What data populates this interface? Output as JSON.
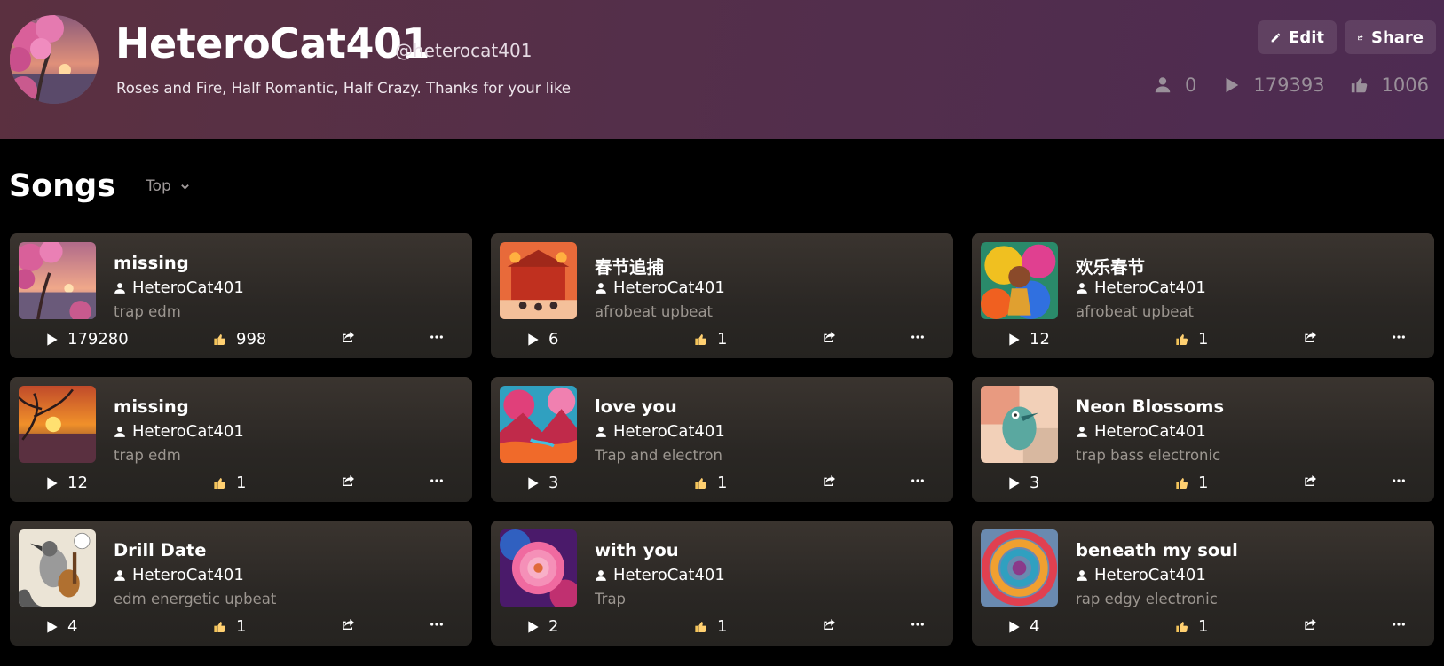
{
  "profile": {
    "name": "HeteroCat401",
    "handle": "@heterocat401",
    "bio": "Roses and Fire, Half Romantic, Half Crazy. Thanks for your like",
    "edit_label": "Edit",
    "share_label": "Share",
    "followers": "0",
    "plays": "179393",
    "likes": "1006"
  },
  "songs_section": {
    "title": "Songs",
    "sort_label": "Top"
  },
  "songs": [
    {
      "title": "missing",
      "artist": "HeteroCat401",
      "genre": "trap edm",
      "plays": "179280",
      "likes": "998",
      "cover": "pink-tree-sunset"
    },
    {
      "title": "春节追捕",
      "artist": "HeteroCat401",
      "genre": "afrobeat upbeat",
      "plays": "6",
      "likes": "1",
      "cover": "red-festival"
    },
    {
      "title": "欢乐春节",
      "artist": "HeteroCat401",
      "genre": "afrobeat upbeat",
      "plays": "12",
      "likes": "1",
      "cover": "colorful-dancer"
    },
    {
      "title": "missing",
      "artist": "HeteroCat401",
      "genre": "trap edm",
      "plays": "12",
      "likes": "1",
      "cover": "sunset-tree"
    },
    {
      "title": "love you",
      "artist": "HeteroCat401",
      "genre": "Trap and electron",
      "plays": "3",
      "likes": "1",
      "cover": "fantasy-landscape"
    },
    {
      "title": "Neon Blossoms",
      "artist": "HeteroCat401",
      "genre": "trap bass electronic",
      "plays": "3",
      "likes": "1",
      "cover": "teal-bird"
    },
    {
      "title": "Drill Date",
      "artist": "HeteroCat401",
      "genre": "edm energetic upbeat",
      "plays": "4",
      "likes": "1",
      "cover": "bird-guitar-sketch"
    },
    {
      "title": "with you",
      "artist": "HeteroCat401",
      "genre": "Trap",
      "plays": "2",
      "likes": "1",
      "cover": "pink-rose"
    },
    {
      "title": "beneath my soul",
      "artist": "HeteroCat401",
      "genre": "rap edgy electronic",
      "plays": "4",
      "likes": "1",
      "cover": "color-swirl"
    }
  ]
}
